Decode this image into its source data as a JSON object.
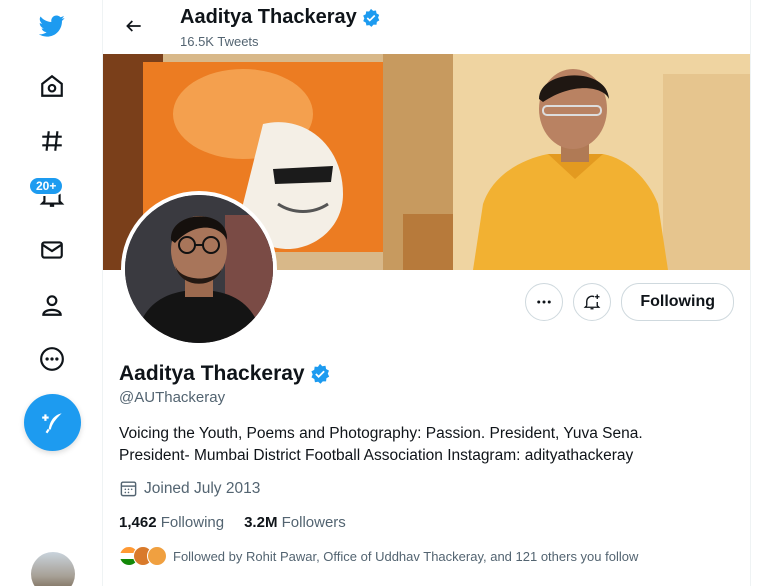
{
  "header": {
    "title": "Aaditya Thackeray",
    "tweet_count": "16.5K Tweets"
  },
  "nav": {
    "items": [
      {
        "name": "twitter-logo-icon"
      },
      {
        "name": "home-icon"
      },
      {
        "name": "explore-hashtag-icon"
      },
      {
        "name": "notifications-bell-icon"
      },
      {
        "name": "messages-mail-icon"
      },
      {
        "name": "profile-person-icon"
      },
      {
        "name": "more-circle-icon"
      }
    ],
    "notification_badge": "20+",
    "compose_icon": "feather-plus-icon"
  },
  "profile": {
    "name": "Aaditya Thackeray",
    "handle": "@AUThackeray",
    "bio_line1": "Voicing the Youth, Poems and Photography: Passion. President, Yuva Sena.",
    "bio_line2": "President- Mumbai District Football Association Instagram: adityathackeray",
    "joined": "Joined July 2013",
    "following_count": "1,462",
    "following_label": "Following",
    "followers_count": "3.2M",
    "followers_label": "Followers",
    "followed_by": "Followed by Rohit Pawar, Office of Uddhav Thackeray, and 121 others you follow"
  },
  "actions": {
    "following_button": "Following"
  },
  "colors": {
    "accent": "#1d9bf0",
    "text_secondary": "#536471",
    "border": "#cfd9de"
  }
}
